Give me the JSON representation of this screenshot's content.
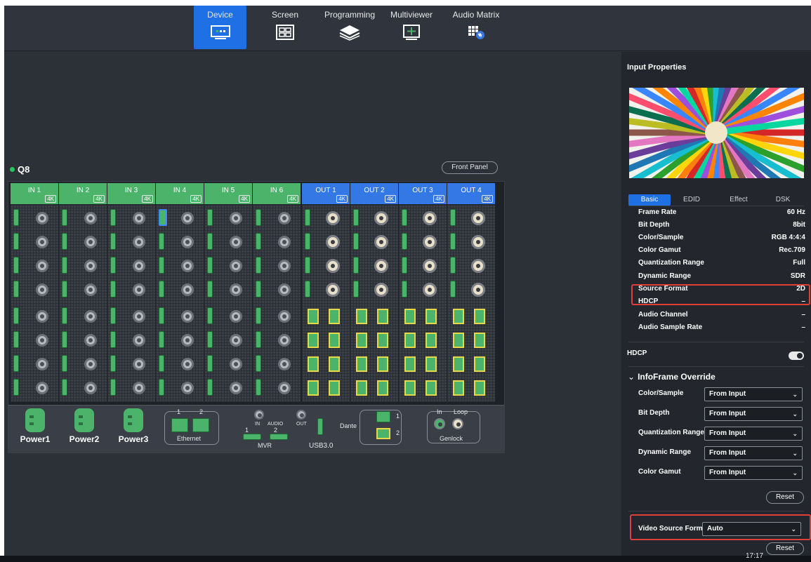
{
  "nav": {
    "tabs": [
      {
        "label": "Device",
        "icon": "device-icon",
        "active": true
      },
      {
        "label": "Screen",
        "icon": "screen-icon",
        "active": false
      },
      {
        "label": "Programming",
        "icon": "layers-icon",
        "active": false
      },
      {
        "label": "Multiviewer",
        "icon": "multiviewer-icon",
        "active": false
      },
      {
        "label": "Audio Matrix",
        "icon": "audio-matrix-icon",
        "active": false
      }
    ]
  },
  "device": {
    "name": "Q8",
    "status_color": "#22c55e",
    "front_panel_label": "Front Panel",
    "input_cards": [
      "IN 1",
      "IN 2",
      "IN 3",
      "IN 4",
      "IN 5",
      "IN 6"
    ],
    "output_cards": [
      "OUT 1",
      "OUT 2",
      "OUT 3",
      "OUT 4"
    ],
    "badge": "4K",
    "power": [
      "Power1",
      "Power2",
      "Power3"
    ],
    "ethernet": {
      "label": "Ethernet",
      "port1": "1",
      "port2": "2"
    },
    "audio": {
      "in": "IN",
      "audio": "AUDIO",
      "out": "OUT"
    },
    "mvr": {
      "label": "MVR",
      "port1": "1",
      "port2": "2"
    },
    "usb_label": "USB3.0",
    "dante": {
      "label": "Dante",
      "port1": "1",
      "port2": "2"
    },
    "genlock": {
      "label": "Genlock",
      "in": "In",
      "loop": "Loop"
    },
    "colors": {
      "input": "#4cb36b",
      "output": "#3478e6",
      "accent": "#1f6fe5"
    }
  },
  "panel": {
    "title": "Input Properties",
    "tabs": [
      "Basic",
      "EDID",
      "Effect",
      "DSK"
    ],
    "active_tab": "Basic",
    "properties": [
      {
        "label": "Frame Rate",
        "value": "60 Hz"
      },
      {
        "label": "Bit Depth",
        "value": "8bit"
      },
      {
        "label": "Color/Sample",
        "value": "RGB 4:4:4"
      },
      {
        "label": "Color Gamut",
        "value": "Rec.709"
      },
      {
        "label": "Quantization Range",
        "value": "Full"
      },
      {
        "label": "Dynamic Range",
        "value": "SDR"
      },
      {
        "label": "Source Format",
        "value": "2D"
      },
      {
        "label": "HDCP",
        "value": "–"
      },
      {
        "label": "Audio Channel",
        "value": "–"
      },
      {
        "label": "Audio Sample Rate",
        "value": "–"
      }
    ],
    "hdcp_label": "HDCP",
    "hdcp_enabled": false,
    "infoframe_title": "InfoFrame Override",
    "infoframe_rows": [
      {
        "label": "Color/Sample",
        "value": "From Input"
      },
      {
        "label": "Bit Depth",
        "value": "From Input"
      },
      {
        "label": "Quantization Range",
        "value": "From Input"
      },
      {
        "label": "Dynamic Range",
        "value": "From Input"
      },
      {
        "label": "Color Gamut",
        "value": "From Input"
      }
    ],
    "reset_label": "Reset",
    "video_source_format_label": "Video Source Format",
    "video_source_format_value": "Auto",
    "highlight_color": "#e0403a"
  },
  "system": {
    "clock": "17:17"
  }
}
